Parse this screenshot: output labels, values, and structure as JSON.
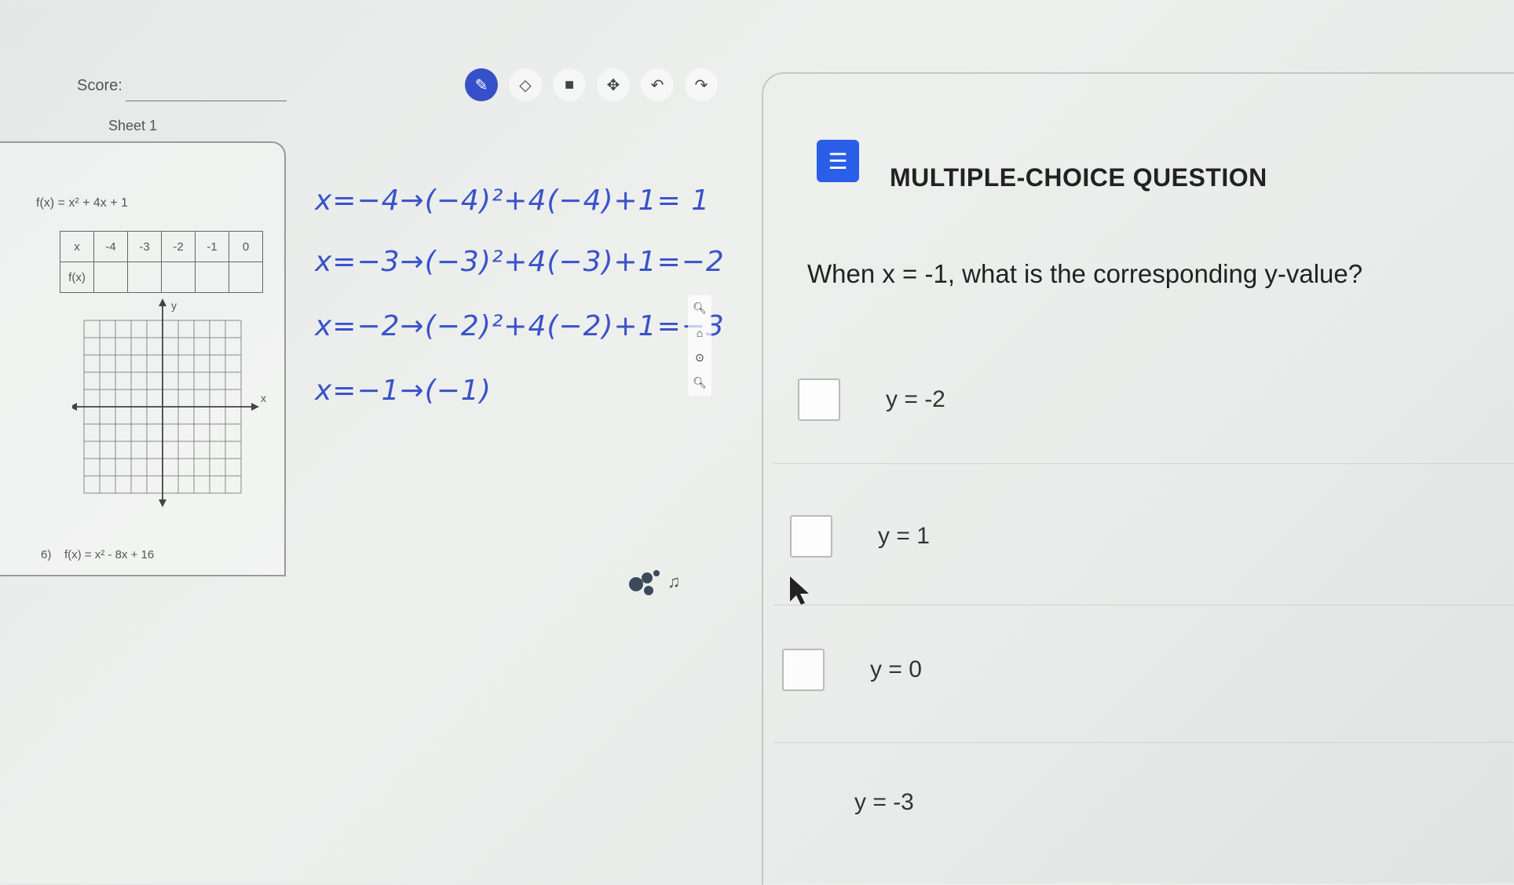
{
  "worksheet": {
    "score_label": "Score:",
    "sheet_tab": "Sheet 1",
    "problem_a": "f(x) = x² + 4x + 1",
    "table": {
      "row_x": [
        "x",
        "-4",
        "-3",
        "-2",
        "-1",
        "0"
      ],
      "row_fx": [
        "f(x)",
        "",
        "",
        "",
        "",
        ""
      ]
    },
    "graph_axis_y": "y",
    "graph_axis_x": "x",
    "problem_b_number": "6)",
    "problem_b": "f(x) = x² - 8x + 16"
  },
  "scratch_work": [
    "x=−4→(−4)²+4(−4)+1= 1",
    "x=−3→(−3)²+4(−3)+1=−2",
    "x=−2→(−2)²+4(−2)+1=−3",
    "x=−1→(−1)"
  ],
  "toolbar": {
    "tools": [
      {
        "name": "pen",
        "glyph": "✎",
        "active": true
      },
      {
        "name": "eraser",
        "glyph": "◇",
        "active": false
      },
      {
        "name": "stop",
        "glyph": "■",
        "active": false
      },
      {
        "name": "move",
        "glyph": "✥",
        "active": false
      },
      {
        "name": "undo",
        "glyph": "↶",
        "active": false
      },
      {
        "name": "redo",
        "glyph": "↷",
        "active": false
      }
    ]
  },
  "question": {
    "type_label": "MULTIPLE-CHOICE QUESTION",
    "text": "When x = -1, what is the corresponding y-value?",
    "choices": [
      "y = -2",
      "y = 1",
      "y = 0",
      "y = -3"
    ]
  }
}
